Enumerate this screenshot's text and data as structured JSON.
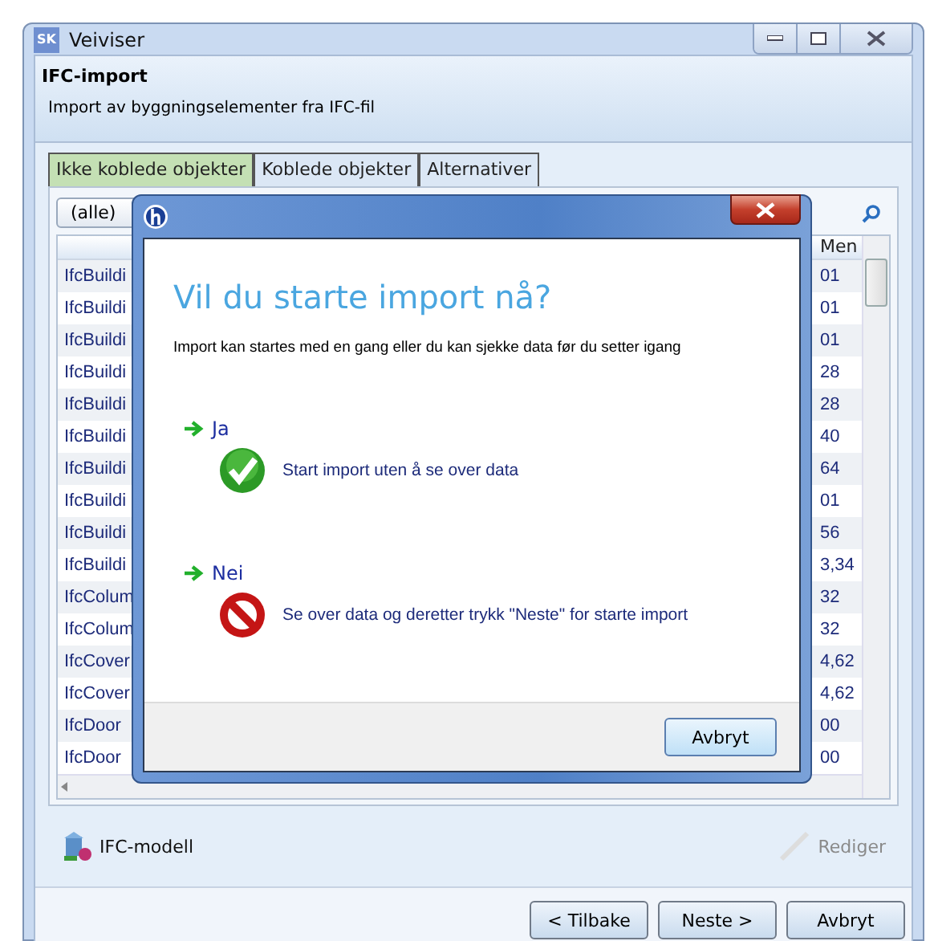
{
  "window": {
    "title": "Veiviser",
    "app_icon": "SK"
  },
  "header": {
    "title": "IFC-import",
    "subtitle": "Import av byggningselementer fra IFC-fil"
  },
  "tabs": [
    {
      "label": "Ikke koblede objekter",
      "selected": true
    },
    {
      "label": "Koblede objekter",
      "selected": false
    },
    {
      "label": "Alternativer",
      "selected": false
    }
  ],
  "filter": {
    "value": "(alle)"
  },
  "table": {
    "columns": [
      "Men"
    ],
    "rows": [
      {
        "column_1": "IfcBuildi",
        "column_2": "01"
      },
      {
        "column_1": "IfcBuildi",
        "column_2": "01"
      },
      {
        "column_1": "IfcBuildi",
        "column_2": "01"
      },
      {
        "column_1": "IfcBuildi",
        "column_2": "28"
      },
      {
        "column_1": "IfcBuildi",
        "column_2": "28"
      },
      {
        "column_1": "IfcBuildi",
        "column_2": "40"
      },
      {
        "column_1": "IfcBuildi",
        "column_2": "64"
      },
      {
        "column_1": "IfcBuildi",
        "column_2": "01"
      },
      {
        "column_1": "IfcBuildi",
        "column_2": "56"
      },
      {
        "column_1": "IfcBuildi",
        "column_2": "3,34"
      },
      {
        "column_1": "IfcColum",
        "column_2": "32"
      },
      {
        "column_1": "IfcColum",
        "column_2": "32"
      },
      {
        "column_1": "IfcCover",
        "column_2": "4,62"
      },
      {
        "column_1": "IfcCover",
        "column_2": "4,62"
      },
      {
        "column_1": "IfcDoor",
        "column_2": "00"
      },
      {
        "column_1": "IfcDoor",
        "column_2": "00"
      }
    ]
  },
  "model_button": "IFC-modell",
  "edit_button": {
    "label": "Rediger",
    "disabled": true
  },
  "footer_buttons": [
    "< Tilbake",
    "Neste >",
    "Avbryt"
  ],
  "dialog": {
    "title": "Vil du starte import nå?",
    "intro": "Import kan startes med en gang eller du kan sjekke data før du setter igang",
    "options": [
      {
        "kind": "yes",
        "label": "Ja",
        "description": "Start import uten å se over data"
      },
      {
        "kind": "no",
        "label": "Nei",
        "description": "Se over data og deretter trykk \"Neste\" for starte import"
      }
    ],
    "cancel": "Avbryt"
  }
}
